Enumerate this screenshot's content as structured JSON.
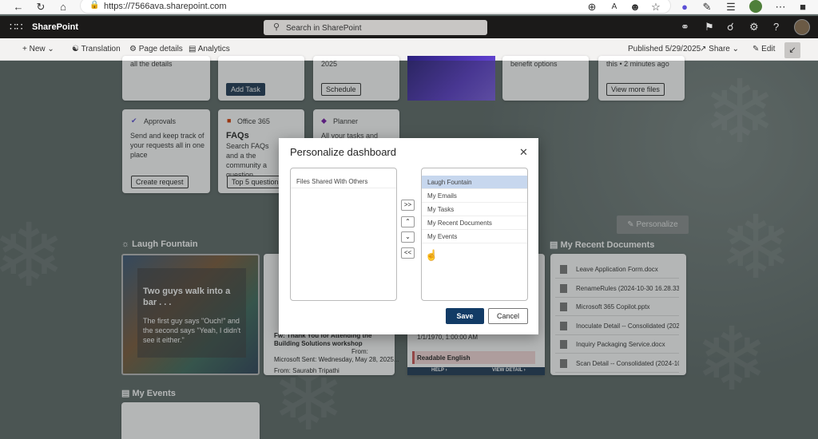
{
  "browser": {
    "url": "https://7566ava.sharepoint.com",
    "icons": [
      "back-icon",
      "refresh-icon",
      "home-icon",
      "zoom-icon",
      "read-aloud-icon",
      "profile-icon",
      "favorite-icon",
      "copilot-icon",
      "extensions-icon",
      "favorites-list-icon",
      "account-avatar",
      "more-icon",
      "window-icon"
    ]
  },
  "suite": {
    "app_name": "SharePoint",
    "search_placeholder": "Search in SharePoint"
  },
  "command_bar": {
    "new": "New",
    "translation": "Translation",
    "page_details": "Page details",
    "analytics": "Analytics",
    "published": "Published 5/29/2025",
    "share": "Share",
    "edit": "Edit"
  },
  "background": {
    "top_cards": {
      "card1_text": "all the details",
      "card2_button": "Add Task",
      "card3_text": "2025",
      "card3_button": "Schedule",
      "card5_text": "benefit options",
      "card6_text": "this • 2 minutes ago",
      "card6_button": "View more files"
    },
    "approvals": {
      "app": "Approvals",
      "text": "Send and keep track of your requests all in one place",
      "button": "Create request"
    },
    "faqs": {
      "app": "Office 365",
      "title": "FAQs",
      "text": "Search FAQs and a the community a question",
      "button": "Top 5 questions"
    },
    "planner": {
      "app": "Planner",
      "text": "All your tasks and"
    },
    "personalize_button": "Personalize",
    "laugh_fountain": {
      "title": "Laugh Fountain",
      "joke_title": "Two guys walk into a bar . . .",
      "joke_body": "The first guy says \"Ouch!\" and the second says \"Yeah, I didn't see it either.\""
    },
    "emails": {
      "subject": "Fw: Thank You for Attending the Building Solutions workshop",
      "from_label": "From:",
      "sent": "Microsoft Sent: Wednesday, May 28, 2025...",
      "from": "From: Saurabh Tripathi"
    },
    "tasks": {
      "date": "1/1/1970, 1:00:00 AM",
      "item": "Readable English",
      "help": "HELP",
      "view_detail": "VIEW DETAIL"
    },
    "recent_docs": {
      "title": "My Recent Documents",
      "items": [
        "Leave Application Form.docx",
        "RenameRules (2024-10-30 16.28.33)....",
        "Microsoft 365 Copilot.pptx",
        "Inoculate Detail -- Consolidated (202...",
        "Inquiry Packaging Service.docx",
        "Scan Detail -- Consolidated (2024-10..."
      ]
    },
    "my_events": "My Events"
  },
  "modal": {
    "title": "Personalize dashboard",
    "left_list": [
      "Files Shared With Others"
    ],
    "right_list": [
      "Laugh Fountain",
      "My Emails",
      "My Tasks",
      "My Recent Documents",
      "My Events"
    ],
    "selected_index": 0,
    "move_all_right": ">>",
    "move_up": "^",
    "move_down": "v",
    "move_all_left": "<<",
    "save": "Save",
    "cancel": "Cancel"
  },
  "colors": {
    "suite_bar": "#1b1a19",
    "primary_button": "#123b66",
    "selected_row": "#c7d7ee"
  }
}
